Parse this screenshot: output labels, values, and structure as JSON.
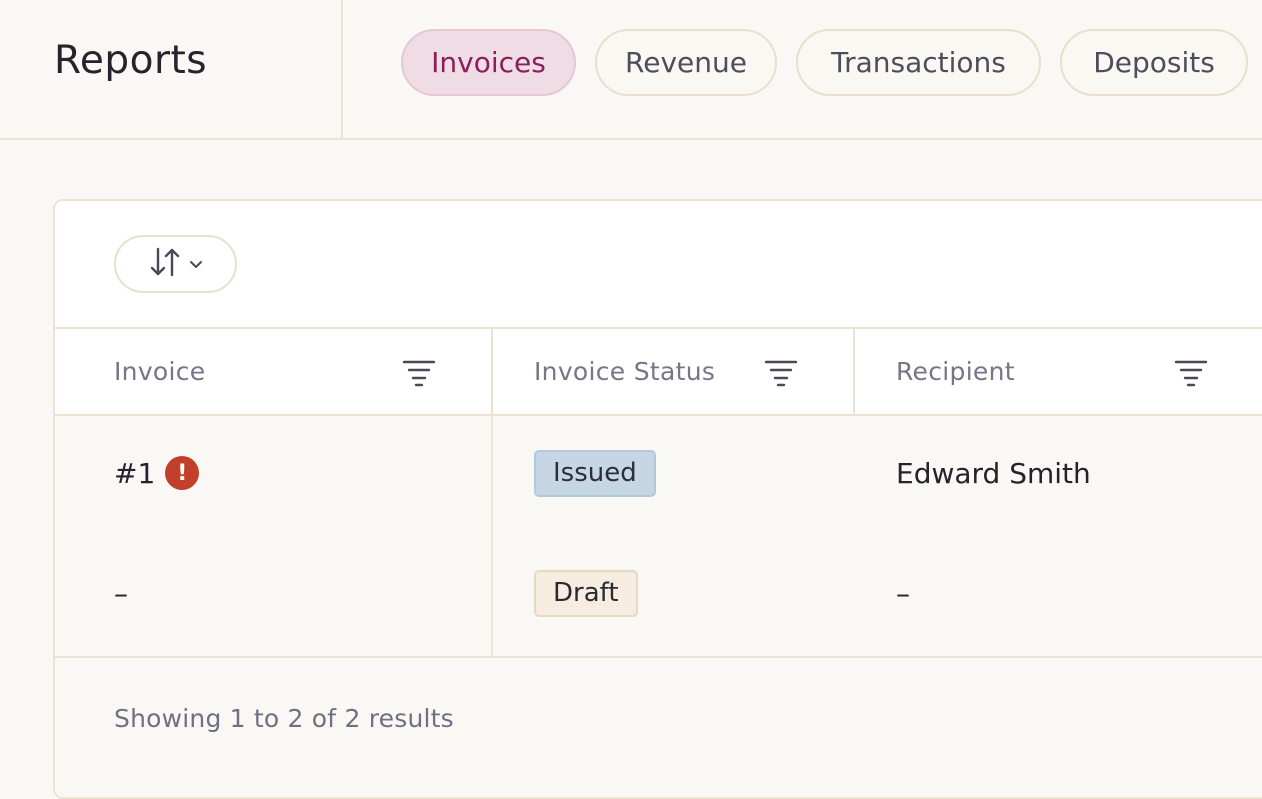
{
  "header": {
    "title": "Reports",
    "tabs": [
      {
        "label": "Invoices",
        "active": true
      },
      {
        "label": "Revenue",
        "active": false
      },
      {
        "label": "Transactions",
        "active": false
      },
      {
        "label": "Deposits",
        "active": false
      }
    ]
  },
  "toolbar": {
    "sort_icon": "sort-arrows-icon",
    "sort_chevron": "chevron-down-icon"
  },
  "table": {
    "columns": [
      {
        "label": "Invoice",
        "filter_icon": "filter-icon"
      },
      {
        "label": "Invoice Status",
        "filter_icon": "filter-icon"
      },
      {
        "label": "Recipient",
        "filter_icon": "filter-icon"
      }
    ],
    "rows": [
      {
        "invoice": "#1",
        "has_alert": true,
        "alert_glyph": "!",
        "status": "Issued",
        "recipient": "Edward Smith"
      },
      {
        "invoice": "–",
        "has_alert": false,
        "status": "Draft",
        "recipient": "–"
      }
    ]
  },
  "footer": {
    "results_text": "Showing 1 to 2 of 2 results"
  },
  "colors": {
    "accent_text": "#8a1f5c",
    "accent_bg": "#efdce4",
    "issued_bg": "#c6d6e5",
    "draft_bg": "#f6ede0",
    "alert": "#c0402b"
  }
}
